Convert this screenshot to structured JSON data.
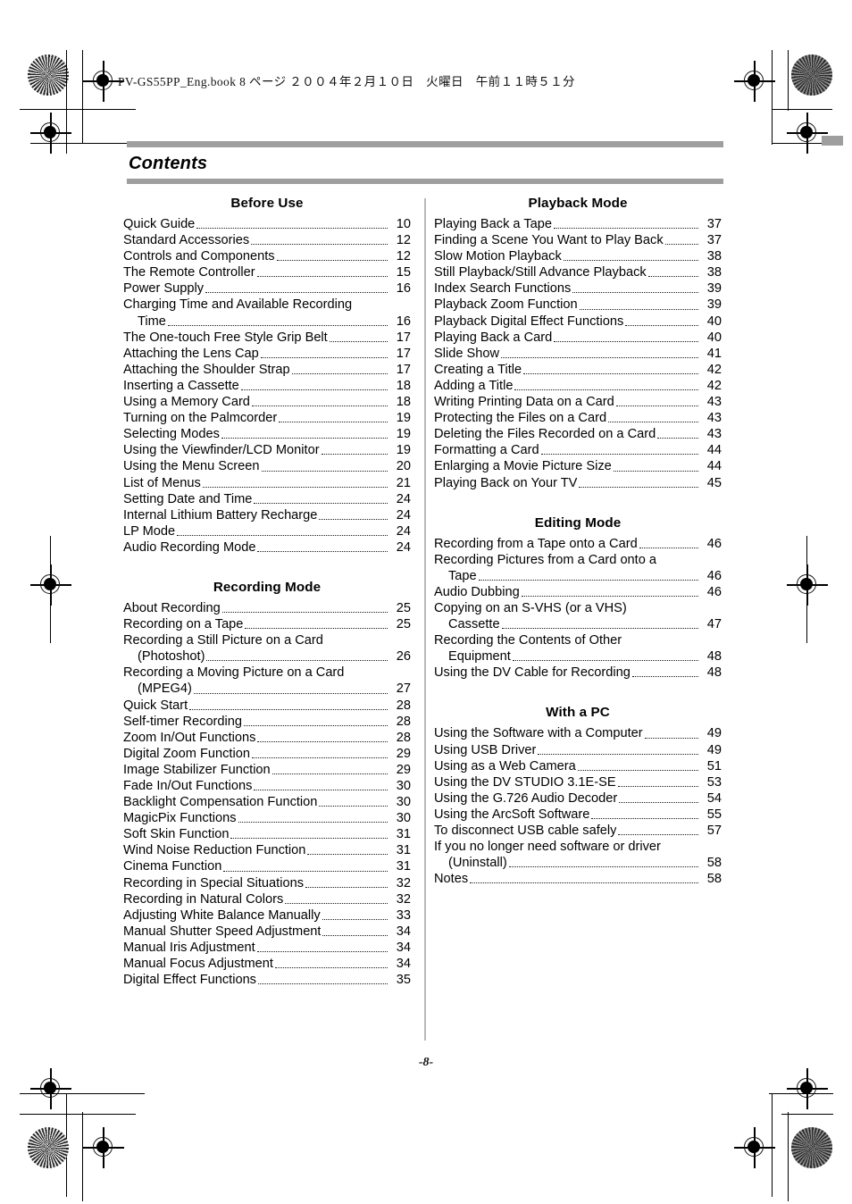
{
  "header": {
    "book_line": "PV-GS55PP_Eng.book  8 ページ  ２００４年２月１０日　火曜日　午前１１時５１分"
  },
  "page_title": "Contents",
  "footer": {
    "page_number": "-8-"
  },
  "colors": {
    "rule_bar": "#9e9e9e",
    "divider": "#b9b9b9",
    "text": "#000000"
  },
  "columns": {
    "left": [
      {
        "heading": "Before Use",
        "entries": [
          {
            "lines": [
              "Quick Guide"
            ],
            "page": "10"
          },
          {
            "lines": [
              "Standard Accessories"
            ],
            "page": "12"
          },
          {
            "lines": [
              "Controls and Components"
            ],
            "page": "12"
          },
          {
            "lines": [
              "The Remote Controller"
            ],
            "page": "15"
          },
          {
            "lines": [
              "Power Supply"
            ],
            "page": "16"
          },
          {
            "lines": [
              "Charging Time and Available Recording",
              "Time"
            ],
            "page": "16"
          },
          {
            "lines": [
              "The One-touch Free Style Grip Belt"
            ],
            "page": "17"
          },
          {
            "lines": [
              "Attaching the Lens Cap"
            ],
            "page": "17"
          },
          {
            "lines": [
              "Attaching the Shoulder Strap"
            ],
            "page": "17"
          },
          {
            "lines": [
              "Inserting a Cassette"
            ],
            "page": "18"
          },
          {
            "lines": [
              "Using a Memory Card"
            ],
            "page": "18"
          },
          {
            "lines": [
              "Turning on the Palmcorder"
            ],
            "page": "19"
          },
          {
            "lines": [
              "Selecting Modes"
            ],
            "page": "19"
          },
          {
            "lines": [
              "Using the Viewfinder/LCD Monitor"
            ],
            "page": "19"
          },
          {
            "lines": [
              "Using the Menu Screen"
            ],
            "page": "20"
          },
          {
            "lines": [
              "List of Menus"
            ],
            "page": "21"
          },
          {
            "lines": [
              "Setting Date and Time"
            ],
            "page": "24"
          },
          {
            "lines": [
              "Internal Lithium Battery Recharge"
            ],
            "page": "24"
          },
          {
            "lines": [
              "LP Mode"
            ],
            "page": "24"
          },
          {
            "lines": [
              "Audio Recording Mode"
            ],
            "page": "24"
          }
        ]
      },
      {
        "heading": "Recording Mode",
        "entries": [
          {
            "lines": [
              "About Recording"
            ],
            "page": "25"
          },
          {
            "lines": [
              "Recording on a Tape"
            ],
            "page": "25"
          },
          {
            "lines": [
              "Recording a Still Picture on a Card",
              "(Photoshot)"
            ],
            "page": "26"
          },
          {
            "lines": [
              "Recording a Moving Picture on a Card",
              "(MPEG4)"
            ],
            "page": "27"
          },
          {
            "lines": [
              "Quick Start"
            ],
            "page": "28"
          },
          {
            "lines": [
              "Self-timer Recording"
            ],
            "page": "28"
          },
          {
            "lines": [
              "Zoom In/Out Functions"
            ],
            "page": "28"
          },
          {
            "lines": [
              "Digital Zoom Function"
            ],
            "page": "29"
          },
          {
            "lines": [
              "Image Stabilizer Function"
            ],
            "page": "29"
          },
          {
            "lines": [
              "Fade In/Out Functions"
            ],
            "page": "30"
          },
          {
            "lines": [
              "Backlight Compensation Function"
            ],
            "page": "30"
          },
          {
            "lines": [
              "MagicPix Functions"
            ],
            "page": "30"
          },
          {
            "lines": [
              "Soft Skin Function"
            ],
            "page": "31"
          },
          {
            "lines": [
              "Wind Noise Reduction Function"
            ],
            "page": "31"
          },
          {
            "lines": [
              "Cinema Function"
            ],
            "page": "31"
          },
          {
            "lines": [
              "Recording in Special Situations"
            ],
            "page": "32"
          },
          {
            "lines": [
              "Recording in Natural Colors"
            ],
            "page": "32"
          },
          {
            "lines": [
              "Adjusting White Balance Manually"
            ],
            "page": "33"
          },
          {
            "lines": [
              "Manual Shutter Speed Adjustment"
            ],
            "page": "34"
          },
          {
            "lines": [
              "Manual Iris Adjustment"
            ],
            "page": "34"
          },
          {
            "lines": [
              "Manual Focus Adjustment"
            ],
            "page": "34"
          },
          {
            "lines": [
              "Digital Effect Functions"
            ],
            "page": "35"
          }
        ]
      }
    ],
    "right": [
      {
        "heading": "Playback Mode",
        "entries": [
          {
            "lines": [
              "Playing Back a Tape"
            ],
            "page": "37"
          },
          {
            "lines": [
              "Finding a Scene You Want to Play Back"
            ],
            "page": "37"
          },
          {
            "lines": [
              "Slow Motion Playback"
            ],
            "page": "38"
          },
          {
            "lines": [
              "Still Playback/Still Advance Playback"
            ],
            "page": "38"
          },
          {
            "lines": [
              "Index Search Functions"
            ],
            "page": "39"
          },
          {
            "lines": [
              "Playback Zoom Function"
            ],
            "page": "39"
          },
          {
            "lines": [
              "Playback Digital Effect Functions"
            ],
            "page": "40"
          },
          {
            "lines": [
              "Playing Back a Card"
            ],
            "page": "40"
          },
          {
            "lines": [
              "Slide Show"
            ],
            "page": "41"
          },
          {
            "lines": [
              "Creating a Title"
            ],
            "page": "42"
          },
          {
            "lines": [
              "Adding a Title"
            ],
            "page": "42"
          },
          {
            "lines": [
              "Writing Printing Data on a Card"
            ],
            "page": "43"
          },
          {
            "lines": [
              "Protecting the Files on a Card"
            ],
            "page": "43"
          },
          {
            "lines": [
              "Deleting the Files Recorded on a Card"
            ],
            "page": "43"
          },
          {
            "lines": [
              "Formatting a Card"
            ],
            "page": "44"
          },
          {
            "lines": [
              "Enlarging a Movie Picture Size"
            ],
            "page": "44"
          },
          {
            "lines": [
              "Playing Back on Your TV"
            ],
            "page": "45"
          }
        ]
      },
      {
        "heading": "Editing Mode",
        "entries": [
          {
            "lines": [
              "Recording from a Tape onto a Card"
            ],
            "page": "46"
          },
          {
            "lines": [
              "Recording Pictures from a Card onto a",
              "Tape"
            ],
            "page": "46"
          },
          {
            "lines": [
              "Audio Dubbing"
            ],
            "page": "46"
          },
          {
            "lines": [
              "Copying on an S-VHS (or a VHS)",
              "Cassette"
            ],
            "page": "47"
          },
          {
            "lines": [
              "Recording the Contents of Other",
              "Equipment"
            ],
            "page": "48"
          },
          {
            "lines": [
              "Using the DV Cable for Recording"
            ],
            "page": "48"
          }
        ]
      },
      {
        "heading": "With a PC",
        "entries": [
          {
            "lines": [
              "Using the Software with a Computer"
            ],
            "page": "49"
          },
          {
            "lines": [
              "Using USB Driver"
            ],
            "page": "49"
          },
          {
            "lines": [
              "Using as a Web Camera"
            ],
            "page": "51"
          },
          {
            "lines": [
              "Using the DV STUDIO 3.1E-SE"
            ],
            "page": "53"
          },
          {
            "lines": [
              "Using the G.726 Audio Decoder"
            ],
            "page": "54"
          },
          {
            "lines": [
              "Using the ArcSoft Software"
            ],
            "page": "55"
          },
          {
            "lines": [
              "To disconnect USB cable safely"
            ],
            "page": "57"
          },
          {
            "lines": [
              "If you no longer need software or driver",
              "(Uninstall)"
            ],
            "page": "58"
          },
          {
            "lines": [
              "Notes"
            ],
            "page": "58"
          }
        ]
      }
    ]
  }
}
